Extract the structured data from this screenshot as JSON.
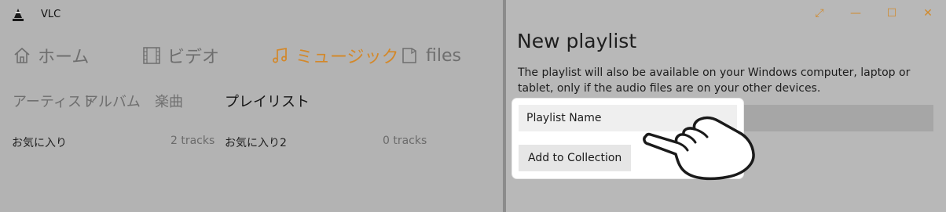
{
  "app": {
    "title": "VLC"
  },
  "nav": [
    {
      "label": "ホーム",
      "icon": "home-icon"
    },
    {
      "label": "ビデオ",
      "icon": "film-icon"
    },
    {
      "label": "ミュージック",
      "icon": "music-note-icon"
    },
    {
      "label": "files",
      "icon": "folder-icon"
    }
  ],
  "active_nav_color": "#d3882a",
  "subnav": [
    "アーティスト",
    "アルバム",
    "楽曲",
    "プレイリスト"
  ],
  "playlists": [
    {
      "name": "お気に入り",
      "count": "2 tracks"
    },
    {
      "name": "お気に入り2",
      "count": "0 tracks"
    }
  ],
  "dialog": {
    "title": "New playlist",
    "description": "The playlist will also be available on your Windows computer, laptop or tablet, only if the audio files are on your other devices.",
    "name_placeholder": "Playlist Name",
    "add_button": "Add to Collection"
  },
  "window_controls": [
    "⤢",
    "—",
    "☐",
    "✕"
  ]
}
